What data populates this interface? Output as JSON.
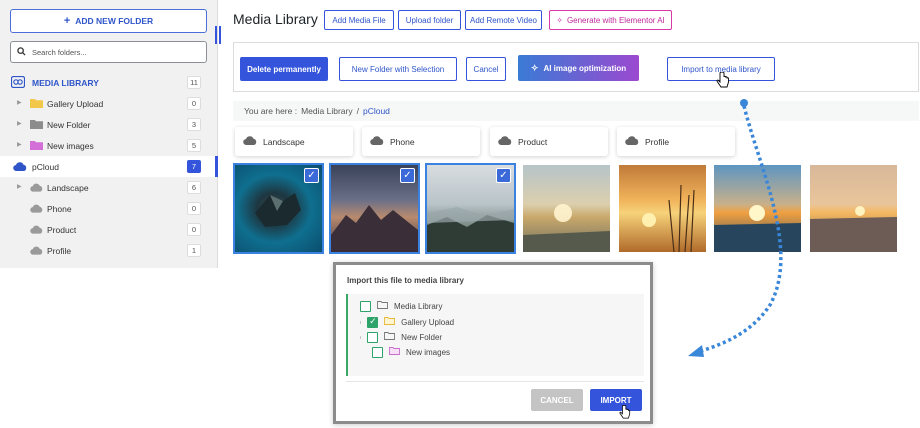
{
  "sidebar": {
    "add_folder_label": "ADD NEW FOLDER",
    "search_placeholder": "Search folders...",
    "items": [
      {
        "label": "MEDIA LIBRARY",
        "count": "11"
      },
      {
        "label": "Gallery Upload",
        "count": "0"
      },
      {
        "label": "New Folder",
        "count": "3"
      },
      {
        "label": "New images",
        "count": "5"
      },
      {
        "label": "pCloud",
        "count": "7"
      },
      {
        "label": "Landscape",
        "count": "6"
      },
      {
        "label": "Phone",
        "count": "0"
      },
      {
        "label": "Product",
        "count": "0"
      },
      {
        "label": "Profile",
        "count": "1"
      }
    ]
  },
  "header": {
    "title": "Media Library",
    "add_media_label": "Add Media File",
    "upload_folder_label": "Upload folder",
    "add_remote_label": "Add Remote Video",
    "elementor_label": "Generate with Elementor AI"
  },
  "toolbar": {
    "delete_label": "Delete permanently",
    "new_folder_sel_label": "New Folder with Selection",
    "cancel_label": "Cancel",
    "ai_label": "AI image optimization",
    "import_label": "Import to media library"
  },
  "breadcrumb": {
    "prefix": "You are here :",
    "item1": "Media Library",
    "sep": "/",
    "current": "pCloud"
  },
  "subfolders": [
    "Landscape",
    "Phone",
    "Product",
    "Profile"
  ],
  "thumbnails": [
    {
      "name": "island-aerial",
      "selected": true
    },
    {
      "name": "mountains-dusk",
      "selected": true
    },
    {
      "name": "misty-valley",
      "selected": true
    },
    {
      "name": "foggy-sunrise",
      "selected": false
    },
    {
      "name": "grass-sunset",
      "selected": false
    },
    {
      "name": "sea-sunset",
      "selected": false
    },
    {
      "name": "beach-sunset",
      "selected": false
    }
  ],
  "dialog": {
    "title": "Import this file to media library",
    "items": [
      {
        "label": "Media Library",
        "checked": false
      },
      {
        "label": "Gallery Upload",
        "checked": true
      },
      {
        "label": "New Folder",
        "checked": false
      },
      {
        "label": "New images",
        "checked": false
      }
    ],
    "cancel_label": "CANCEL",
    "import_label": "IMPORT"
  },
  "colors": {
    "accent": "#3455db",
    "ai_gradient_start": "#3a7bd5",
    "ai_gradient_end": "#9b49d0",
    "check_green": "#2ea36a",
    "elementor_pink": "#d63aa8"
  }
}
